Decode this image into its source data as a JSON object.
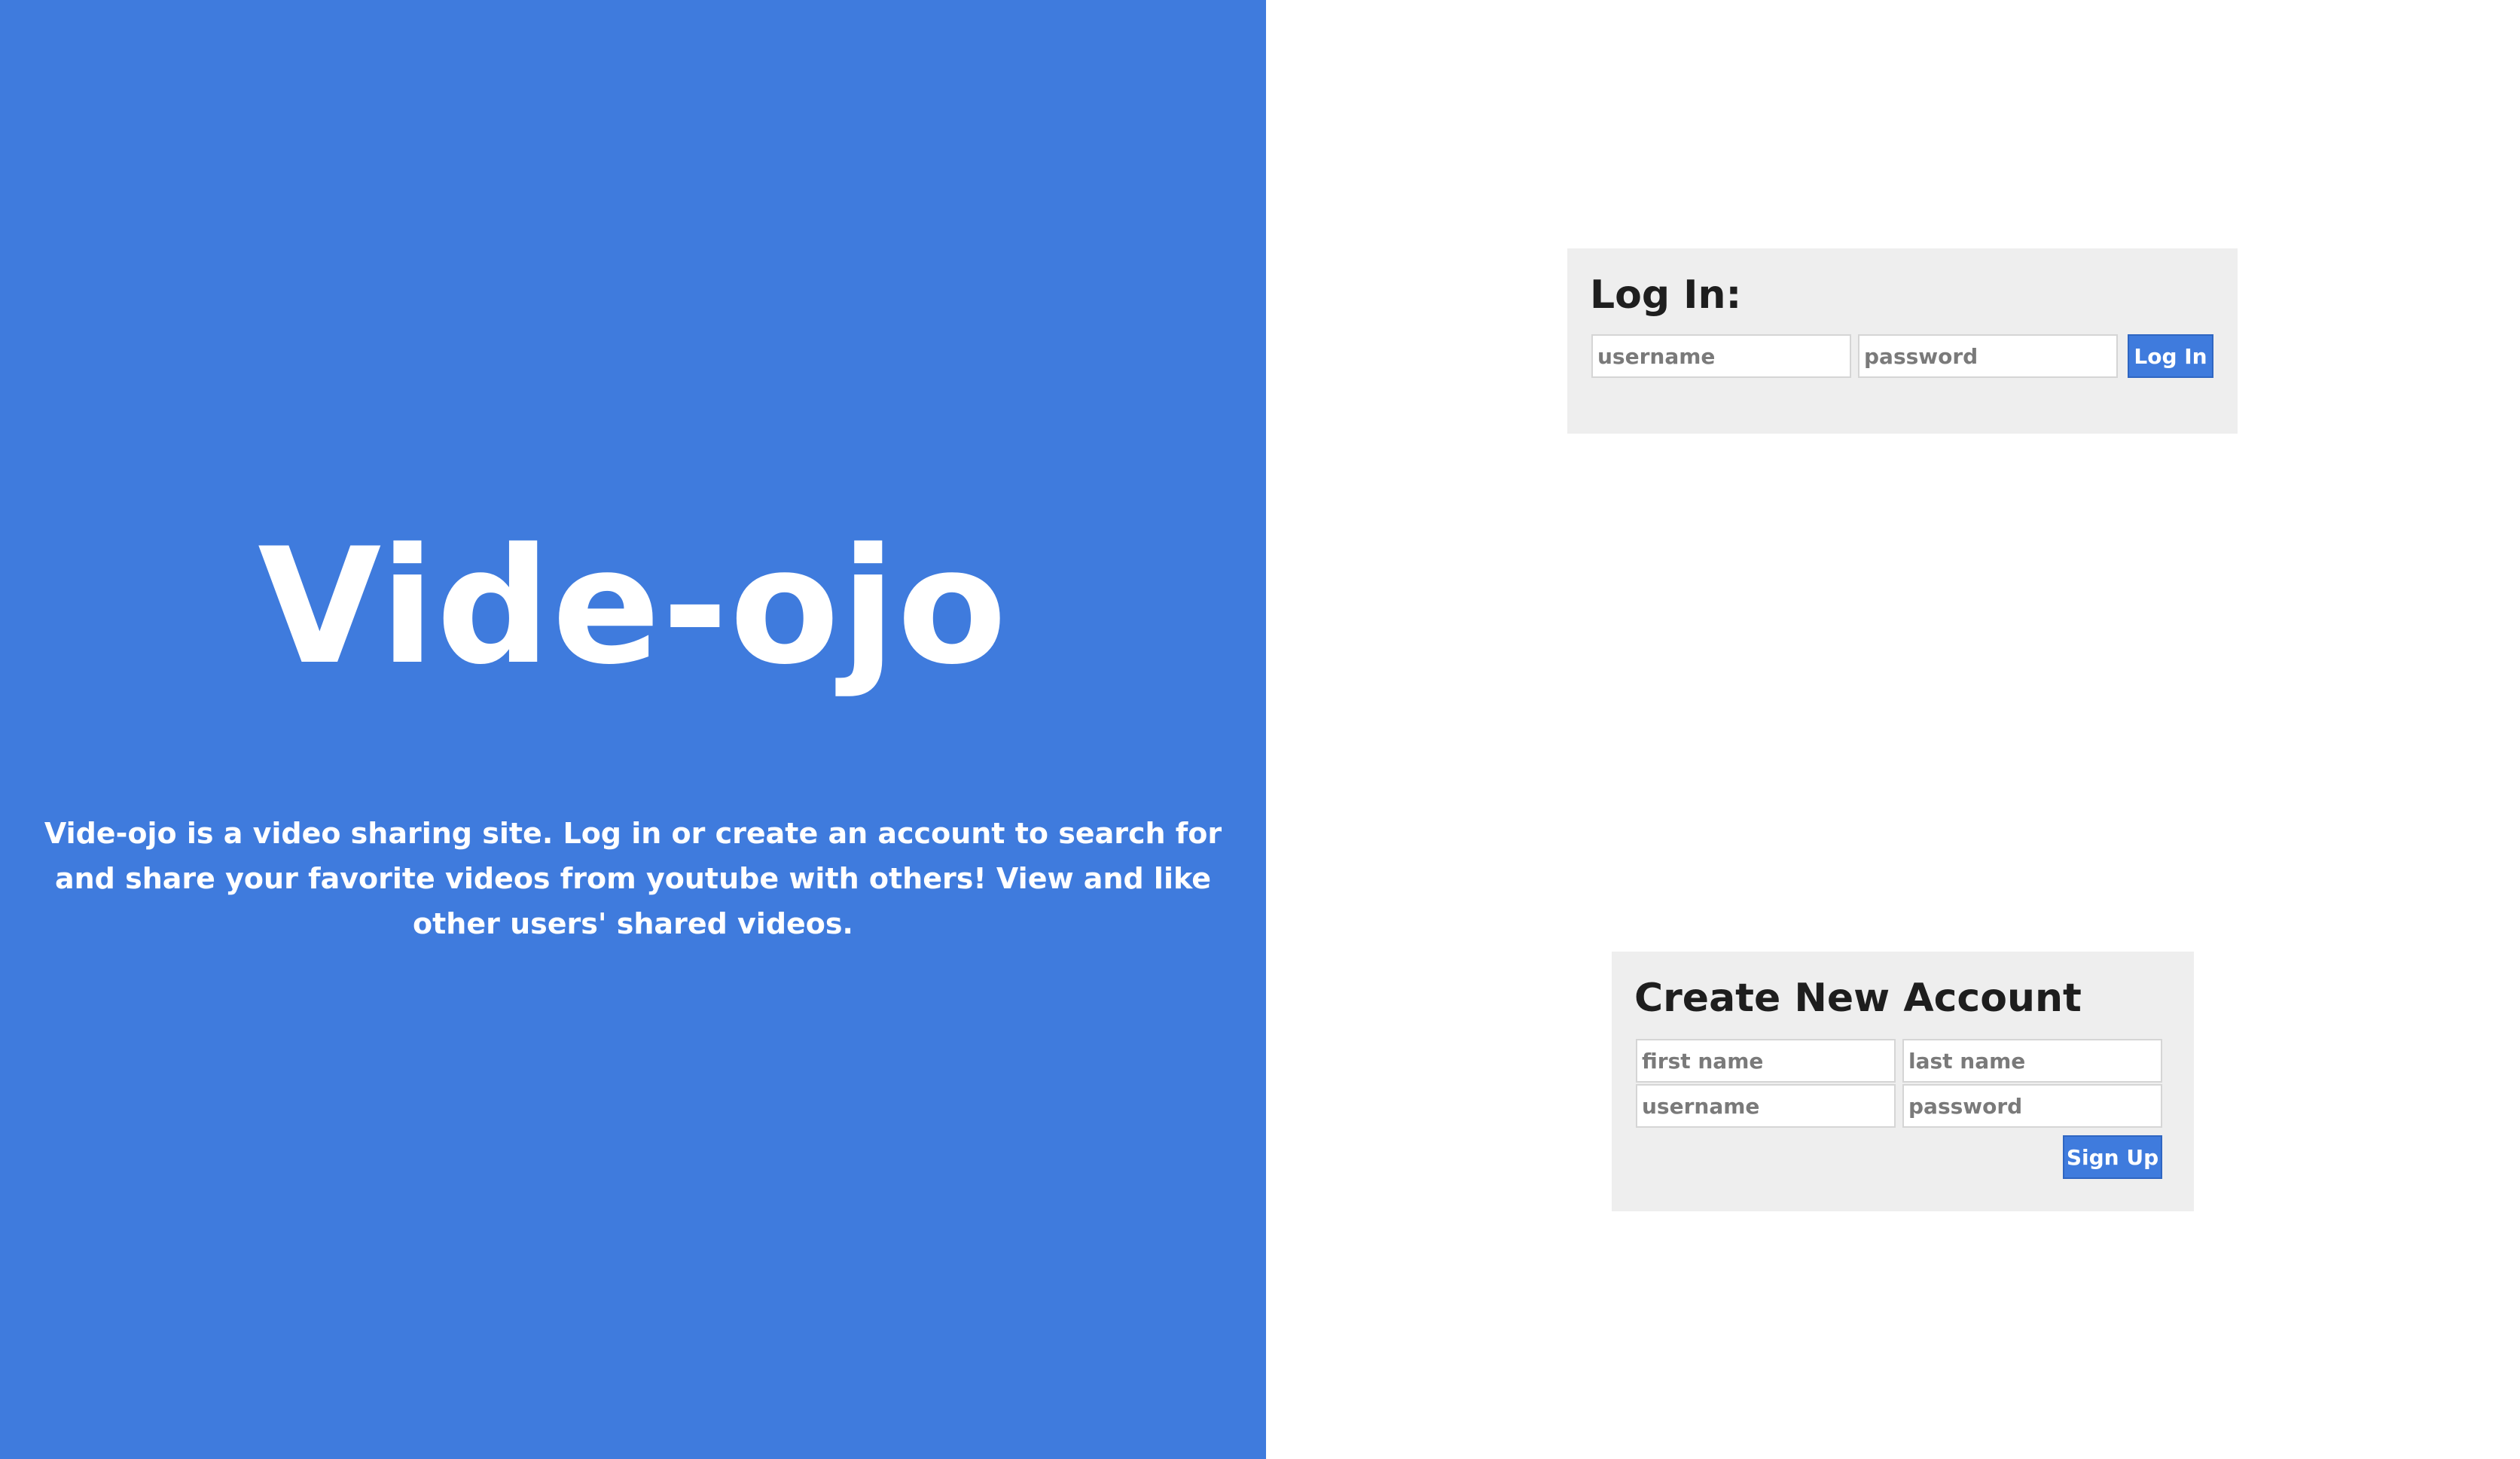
{
  "site": {
    "title": "Vide-ojo",
    "tagline": "Vide-ojo is a video sharing site. Log in or create an account to search for and share your favorite videos from youtube with others! View and like other users' shared videos."
  },
  "login": {
    "heading": "Log In:",
    "username_placeholder": "username",
    "password_placeholder": "password",
    "button_label": "Log In"
  },
  "signup": {
    "heading": "Create New Account",
    "first_name_placeholder": "first name",
    "last_name_placeholder": "last name",
    "username_placeholder": "username",
    "password_placeholder": "password",
    "button_label": "Sign Up"
  },
  "colors": {
    "accent": "#3f7bdd",
    "card_background": "#eeeeee",
    "page_background": "#ffffff"
  }
}
